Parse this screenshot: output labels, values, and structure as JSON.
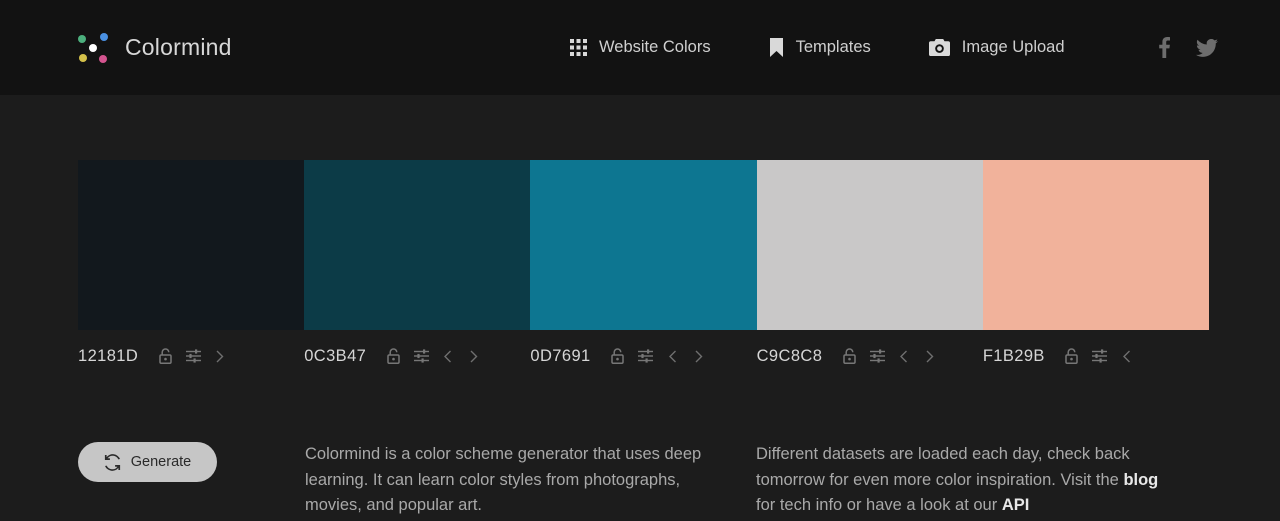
{
  "header": {
    "brand_name": "Colormind",
    "nav": [
      {
        "label": "Website Colors",
        "icon": "grid-icon"
      },
      {
        "label": "Templates",
        "icon": "bookmark-icon"
      },
      {
        "label": "Image Upload",
        "icon": "camera-icon"
      }
    ],
    "social": [
      {
        "name": "facebook-icon"
      },
      {
        "name": "twitter-icon"
      }
    ]
  },
  "palette": {
    "swatches": [
      {
        "hex": "12181D",
        "color": "#12181D",
        "lock": "unlocked",
        "has_prev": false,
        "has_next": true
      },
      {
        "hex": "0C3B47",
        "color": "#0C3B47",
        "lock": "unlocked",
        "has_prev": true,
        "has_next": true
      },
      {
        "hex": "0D7691",
        "color": "#0D7691",
        "lock": "unlocked",
        "has_prev": true,
        "has_next": true
      },
      {
        "hex": "C9C8C8",
        "color": "#C9C8C8",
        "lock": "unlocked",
        "has_prev": true,
        "has_next": true
      },
      {
        "hex": "F1B29B",
        "color": "#F1B29B",
        "lock": "unlocked",
        "has_prev": true,
        "has_next": false
      }
    ]
  },
  "actions": {
    "generate_label": "Generate"
  },
  "blurbs": {
    "left": "Colormind is a color scheme generator that uses deep learning. It can learn color styles from photographs, movies, and popular art.",
    "right_part1": "Different datasets are loaded each day, check back tomorrow for even more color inspiration. Visit the ",
    "right_link1": "blog",
    "right_part2": " for tech info or have a look at our ",
    "right_link2": "API"
  }
}
